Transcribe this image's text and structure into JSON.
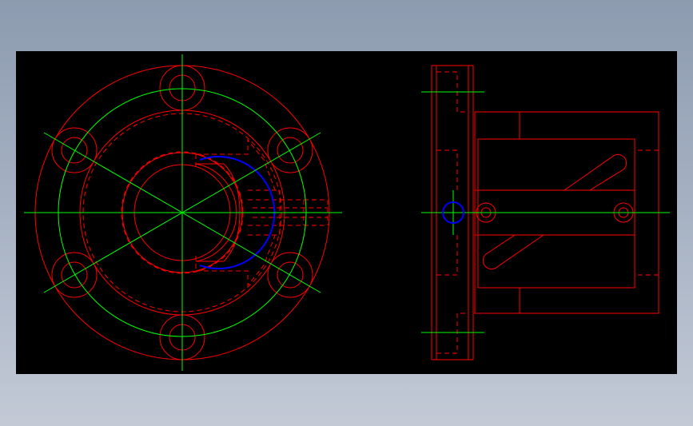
{
  "colors": {
    "background": "#000000",
    "outline": "#ff0000",
    "centerline": "#00ff00",
    "highlight": "#0000ff"
  }
}
